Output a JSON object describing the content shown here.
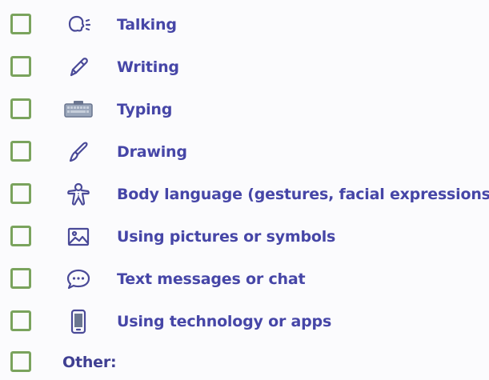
{
  "theme": {
    "checkbox_border": "#7aa35d",
    "label_color": "#4646a7",
    "icon_color": "#4a4a98",
    "background": "#fbfbfd"
  },
  "options": [
    {
      "label": "Talking",
      "icon": "talking-head-icon",
      "checked": false
    },
    {
      "label": "Writing",
      "icon": "pencil-icon",
      "checked": false
    },
    {
      "label": "Typing",
      "icon": "keyboard-icon",
      "checked": false
    },
    {
      "label": "Drawing",
      "icon": "paintbrush-icon",
      "checked": false
    },
    {
      "label": "Body language (gestures, facial expressions)",
      "icon": "gingerbread-person-icon",
      "checked": false
    },
    {
      "label": "Using pictures or symbols",
      "icon": "picture-icon",
      "checked": false
    },
    {
      "label": "Text messages or chat",
      "icon": "chat-bubble-icon",
      "checked": false
    },
    {
      "label": "Using technology or apps",
      "icon": "phone-icon",
      "checked": false
    }
  ],
  "other": {
    "label": "Other:",
    "value": "",
    "checked": false
  }
}
